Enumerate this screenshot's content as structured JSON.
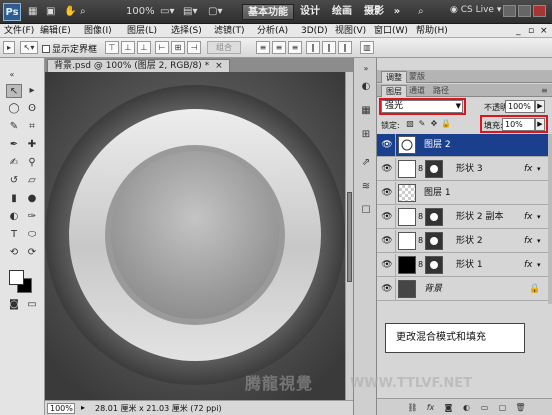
{
  "appbar": {
    "logo": "Ps",
    "zoom": "100%",
    "workspace_active": "基本功能",
    "workspaces": [
      "设计",
      "绘画",
      "摄影"
    ],
    "more": "»",
    "cslive": "CS Live"
  },
  "menu": [
    "文件(F)",
    "编辑(E)",
    "图像(I)",
    "图层(L)",
    "选择(S)",
    "滤镜(T)",
    "分析(A)",
    "3D(D)",
    "视图(V)",
    "窗口(W)",
    "帮助(H)"
  ],
  "options": {
    "show_bounds": "显示定界框",
    "combine": "组合"
  },
  "document": {
    "tab_title": "背景.psd @ 100% (图层 2, RGB/8) *",
    "close": "×",
    "zoom": "100%",
    "doc_size": "28.01 厘米 x 21.03 厘米 (72 ppi)"
  },
  "panels": {
    "top_tabs": [
      "调整",
      "蒙版"
    ],
    "layer_tabs": [
      "图层",
      "通道",
      "路径"
    ],
    "blend_mode": "强光",
    "opacity_label": "不透明度:",
    "opacity": "100%",
    "lock_label": "锁定:",
    "fill_label": "填充:",
    "fill": "10%",
    "layers": [
      {
        "name": "图层 2",
        "thumb": "white-line",
        "mask": false,
        "fx": false,
        "selected": true
      },
      {
        "name": "形状 3",
        "thumb": "white",
        "mask": true,
        "fx": true,
        "selected": false
      },
      {
        "name": "图层 1",
        "thumb": "checker",
        "mask": false,
        "fx": false,
        "selected": false
      },
      {
        "name": "形状 2 副本",
        "thumb": "white",
        "mask": true,
        "fx": true,
        "selected": false
      },
      {
        "name": "形状 2",
        "thumb": "white",
        "mask": true,
        "fx": true,
        "selected": false
      },
      {
        "name": "形状 1",
        "thumb": "black",
        "mask": true,
        "fx": true,
        "selected": false
      },
      {
        "name": "背景",
        "thumb": "dark",
        "mask": false,
        "fx": false,
        "selected": false,
        "locked": true
      }
    ],
    "fx_label": "fx"
  },
  "annotation": "更改混合模式和填充",
  "watermark": "腾龍視覺",
  "watermark_url": "WWW.TTLVF.NET",
  "colors": {
    "selection_blue": "#1a3f8c",
    "highlight_red": "#e0141e",
    "canvas_gray": "#6e6e6e"
  }
}
